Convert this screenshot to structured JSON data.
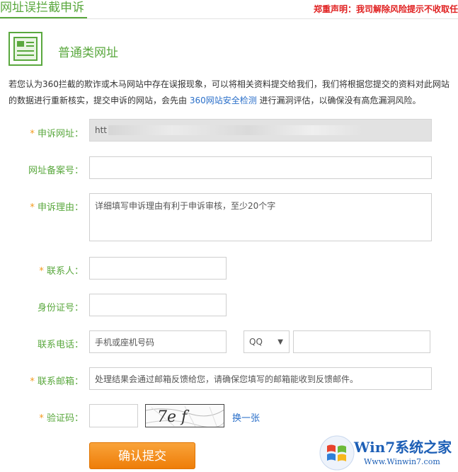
{
  "header": {
    "title": "网址误拦截申诉",
    "notice": "郑重声明：我司解除风险提示不收取任"
  },
  "section": {
    "icon": "document-icon",
    "title": "普通类网址"
  },
  "intro": {
    "text_before": "若您认为360拦截的欺诈或木马网站中存在误报现象，可以将相关资料提交给我们，我们将根据您提交的资料对此网站的数据进行重新核实，提交申诉的网站，会先由 ",
    "link": "360网站安全检测",
    "text_after": " 进行漏洞评估，以确保没有高危漏洞风险。"
  },
  "form": {
    "url": {
      "label": "申诉网址：",
      "required": "*",
      "value": "htt"
    },
    "icp": {
      "label": "网址备案号：",
      "value": ""
    },
    "reason": {
      "label": "申诉理由：",
      "required": "*",
      "placeholder": "详细填写申诉理由有利于申诉审核，至少20个字"
    },
    "contact": {
      "label": "联系人：",
      "required": "*",
      "value": ""
    },
    "idcard": {
      "label": "身份证号：",
      "value": ""
    },
    "phone": {
      "label": "联系电话：",
      "placeholder": "手机或座机号码",
      "im_type": "QQ",
      "im_value": ""
    },
    "email": {
      "label": "联系邮箱：",
      "required": "*",
      "placeholder": "处理结果会通过邮箱反馈给您，请确保您填写的邮箱能收到反馈邮件。"
    },
    "captcha": {
      "label": "验证码：",
      "required": "*",
      "value": "",
      "image_text": "7e f",
      "refresh": "换一张"
    },
    "submit": "确认提交"
  },
  "watermark": {
    "brand": "Win7系统之家",
    "url": "Www.Winwin7.com"
  },
  "colors": {
    "accent_green": "#5aa83e",
    "required_star": "#f39a1e",
    "link_blue": "#2a6fc9",
    "submit_orange": "#f39214",
    "notice_red": "#e02020"
  }
}
